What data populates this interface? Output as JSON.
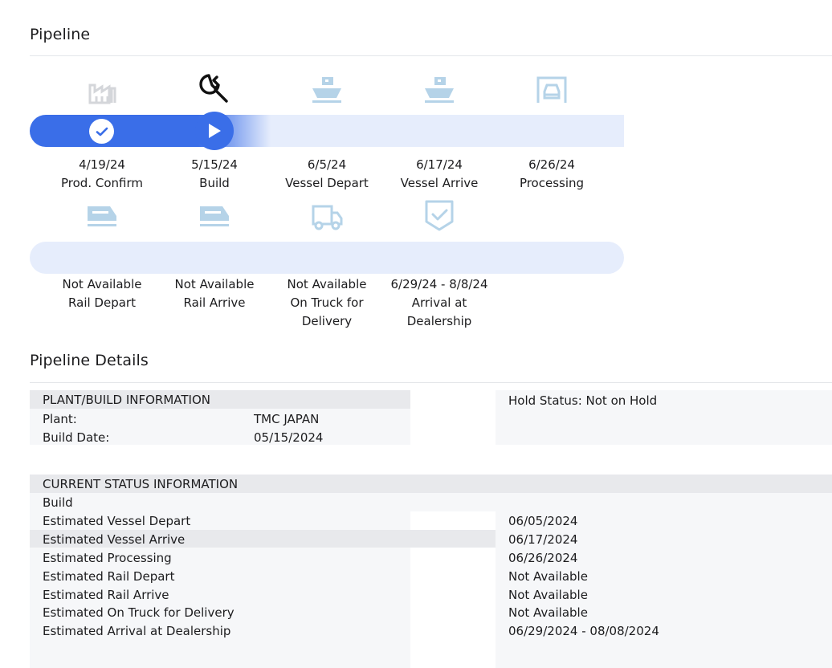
{
  "pipeline": {
    "title": "Pipeline",
    "top_steps": [
      {
        "date": "4/19/24",
        "label": "Prod. Confirm",
        "icon": "factory-icon",
        "status": "complete"
      },
      {
        "date": "5/15/24",
        "label": "Build",
        "icon": "wrench-icon",
        "status": "current"
      },
      {
        "date": "6/5/24",
        "label": "Vessel Depart",
        "icon": "ship-icon",
        "status": "pending"
      },
      {
        "date": "6/17/24",
        "label": "Vessel Arrive",
        "icon": "ship-icon",
        "status": "pending"
      },
      {
        "date": "6/26/24",
        "label": "Processing",
        "icon": "car-garage-icon",
        "status": "pending"
      }
    ],
    "bottom_steps": [
      {
        "date": "Not Available",
        "label": "Rail Depart",
        "icon": "rail-icon"
      },
      {
        "date": "Not Available",
        "label": "Rail Arrive",
        "icon": "rail-icon"
      },
      {
        "date": "Not Available",
        "label_line1": "On Truck for",
        "label_line2": "Delivery",
        "icon": "truck-icon"
      },
      {
        "date": "6/29/24 - 8/8/24",
        "label_line1": "Arrival at",
        "label_line2": "Dealership",
        "icon": "shield-check-icon"
      }
    ],
    "colors": {
      "progress": "#3a6ee8",
      "track": "#e6edfc",
      "inactive_icon": "#b5d3e8"
    }
  },
  "details": {
    "title": "Pipeline Details",
    "plant_build": {
      "header": "PLANT/BUILD INFORMATION",
      "rows": [
        {
          "label": "Plant:",
          "value": "TMC JAPAN"
        },
        {
          "label": "Build Date:",
          "value": "05/15/2024"
        }
      ]
    },
    "hold_status": "Hold Status: Not on Hold",
    "current_status": {
      "header": "CURRENT STATUS INFORMATION",
      "current": "Build",
      "rows": [
        {
          "label": "Estimated Vessel Depart",
          "value": "06/05/2024"
        },
        {
          "label": "Estimated Vessel Arrive",
          "value": "06/17/2024"
        },
        {
          "label": "Estimated Processing",
          "value": "06/26/2024"
        },
        {
          "label": "Estimated Rail Depart",
          "value": "Not Available"
        },
        {
          "label": "Estimated Rail Arrive",
          "value": "Not Available"
        },
        {
          "label": "Estimated On Truck for Delivery",
          "value": "Not Available"
        },
        {
          "label": "Estimated Arrival at Dealership",
          "value": "06/29/2024 - 08/08/2024"
        }
      ]
    }
  }
}
